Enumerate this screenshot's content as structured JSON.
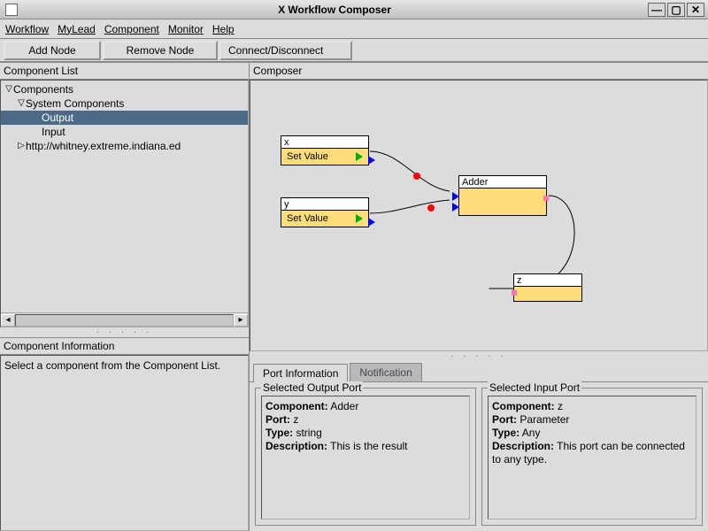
{
  "window": {
    "title": "X Workflow Composer"
  },
  "menubar": {
    "items": [
      "Workflow",
      "MyLead",
      "Component",
      "Monitor"
    ],
    "help": "Help"
  },
  "toolbar": {
    "add": "Add Node",
    "remove": "Remove Node",
    "connect": "Connect/Disconnect"
  },
  "left": {
    "list_title": "Component List",
    "tree": {
      "root": "Components",
      "group": "System Components",
      "items": [
        "Output",
        "Input"
      ],
      "extra": "http://whitney.extreme.indiana.ed",
      "selected_index": 0
    },
    "info_title": "Component Information",
    "info_text": "Select a component from the Component List."
  },
  "composer": {
    "title": "Composer"
  },
  "nodes": {
    "x": {
      "label": "x",
      "button": "Set Value"
    },
    "y": {
      "label": "y",
      "button": "Set Value"
    },
    "adder": {
      "label": "Adder"
    },
    "z": {
      "label": "z"
    }
  },
  "tabs": {
    "port_info": "Port Information",
    "notification": "Notification"
  },
  "output_port": {
    "legend": "Selected Output Port",
    "component": "Adder",
    "port": "z",
    "type": "string",
    "description": "This is the result"
  },
  "input_port": {
    "legend": "Selected Input Port",
    "component": "z",
    "port": "Parameter",
    "type": "Any",
    "description": "This port can be connected to any type."
  },
  "labels": {
    "component": "Component:",
    "port": "Port:",
    "type": "Type:",
    "description": "Description:"
  }
}
